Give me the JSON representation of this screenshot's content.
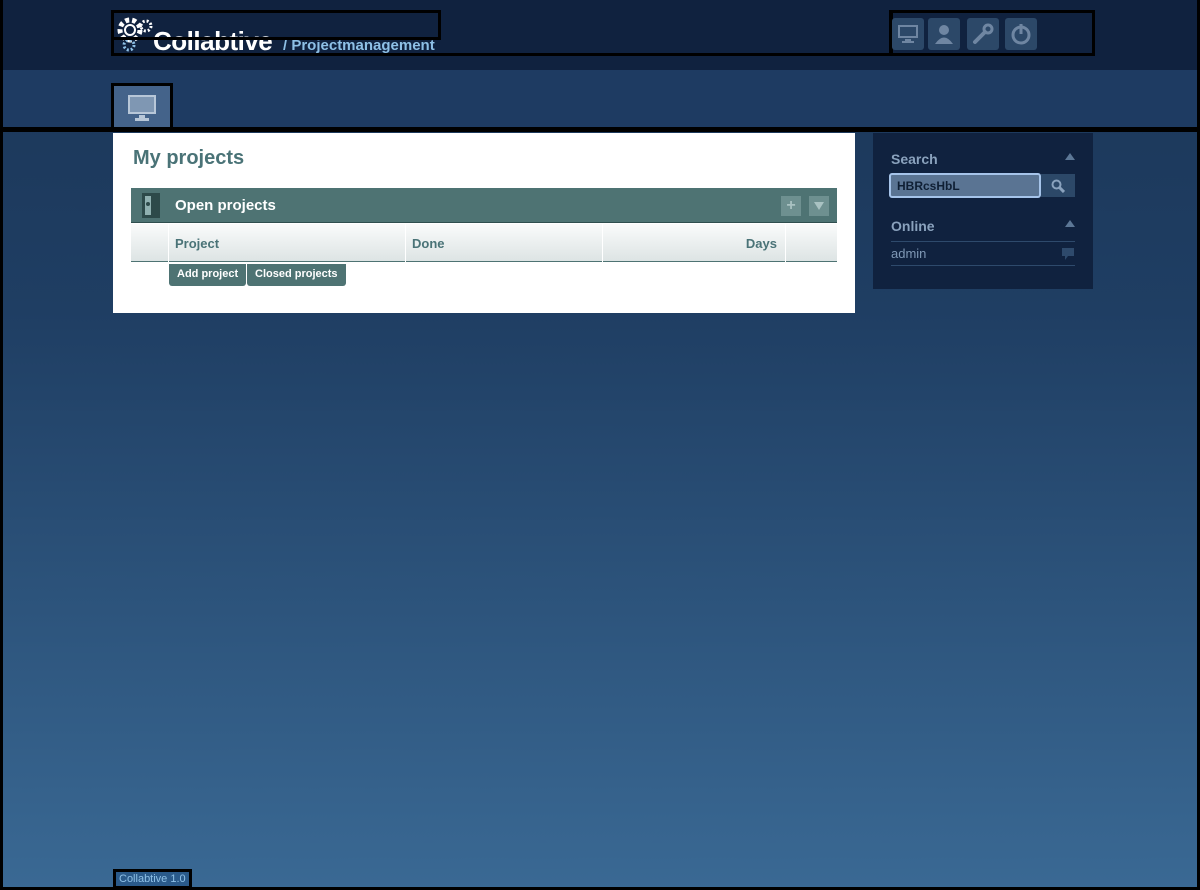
{
  "header": {
    "brand": "Collabtive",
    "subtitle": "/ Projectmanagement",
    "icons": [
      "desktop-icon",
      "user-icon",
      "wrench-icon",
      "power-icon"
    ]
  },
  "tabs": [
    {
      "icon": "desktop-icon"
    }
  ],
  "main": {
    "title": "My projects",
    "block_title": "Open projects",
    "columns": [
      "Project",
      "Done",
      "Days"
    ],
    "buttons": {
      "add": "Add project",
      "closed": "Closed projects"
    }
  },
  "sidebar": {
    "search_title": "Search",
    "search_value": "HBRcsHbL",
    "online_title": "Online",
    "online_users": [
      "admin"
    ]
  },
  "footer": {
    "text": "Collabtive 1.0"
  },
  "colors": {
    "accent": "#4e7373",
    "header": "#10223f",
    "link": "#8ec0e6"
  }
}
